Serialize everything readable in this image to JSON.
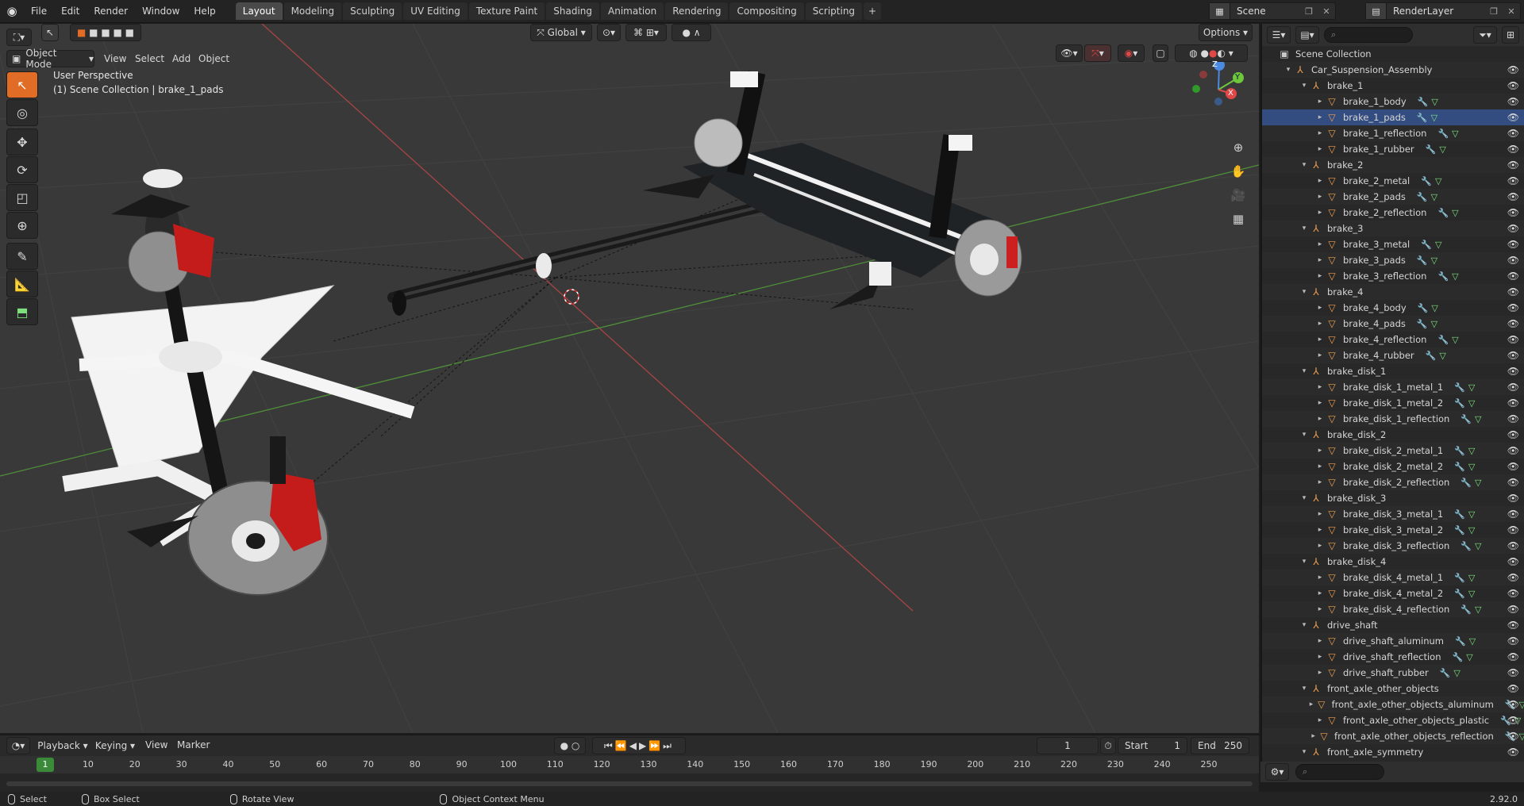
{
  "topbar": {
    "menus": [
      "File",
      "Edit",
      "Render",
      "Window",
      "Help"
    ],
    "workspaces": [
      "Layout",
      "Modeling",
      "Sculpting",
      "UV Editing",
      "Texture Paint",
      "Shading",
      "Animation",
      "Rendering",
      "Compositing",
      "Scripting"
    ],
    "active_workspace": "Layout",
    "add_label": "+",
    "scene": "Scene",
    "render_layer": "RenderLayer"
  },
  "viewport": {
    "mode": "Object Mode",
    "menus": [
      "View",
      "Select",
      "Add",
      "Object"
    ],
    "transform_orientation": "Global",
    "options_label": "Options",
    "perspective_label": "User Perspective",
    "collection_label": "(1) Scene Collection | brake_1_pads"
  },
  "gizmo": {
    "x": "X",
    "y": "Y",
    "z": "Z"
  },
  "outliner": {
    "search_placeholder": "",
    "rows": [
      {
        "name": "Scene Collection",
        "level": 0,
        "kind": "scene"
      },
      {
        "name": "Car_Suspension_Assembly",
        "level": 1,
        "kind": "empty"
      },
      {
        "name": "brake_1",
        "level": 2,
        "kind": "empty"
      },
      {
        "name": "brake_1_body",
        "level": 3,
        "kind": "mesh"
      },
      {
        "name": "brake_1_pads",
        "level": 3,
        "kind": "mesh",
        "selected": true
      },
      {
        "name": "brake_1_reflection",
        "level": 3,
        "kind": "mesh"
      },
      {
        "name": "brake_1_rubber",
        "level": 3,
        "kind": "mesh"
      },
      {
        "name": "brake_2",
        "level": 2,
        "kind": "empty"
      },
      {
        "name": "brake_2_metal",
        "level": 3,
        "kind": "mesh"
      },
      {
        "name": "brake_2_pads",
        "level": 3,
        "kind": "mesh"
      },
      {
        "name": "brake_2_reflection",
        "level": 3,
        "kind": "mesh"
      },
      {
        "name": "brake_3",
        "level": 2,
        "kind": "empty"
      },
      {
        "name": "brake_3_metal",
        "level": 3,
        "kind": "mesh"
      },
      {
        "name": "brake_3_pads",
        "level": 3,
        "kind": "mesh"
      },
      {
        "name": "brake_3_reflection",
        "level": 3,
        "kind": "mesh"
      },
      {
        "name": "brake_4",
        "level": 2,
        "kind": "empty"
      },
      {
        "name": "brake_4_body",
        "level": 3,
        "kind": "mesh"
      },
      {
        "name": "brake_4_pads",
        "level": 3,
        "kind": "mesh"
      },
      {
        "name": "brake_4_reflection",
        "level": 3,
        "kind": "mesh"
      },
      {
        "name": "brake_4_rubber",
        "level": 3,
        "kind": "mesh"
      },
      {
        "name": "brake_disk_1",
        "level": 2,
        "kind": "empty"
      },
      {
        "name": "brake_disk_1_metal_1",
        "level": 3,
        "kind": "mesh"
      },
      {
        "name": "brake_disk_1_metal_2",
        "level": 3,
        "kind": "mesh"
      },
      {
        "name": "brake_disk_1_reflection",
        "level": 3,
        "kind": "mesh"
      },
      {
        "name": "brake_disk_2",
        "level": 2,
        "kind": "empty"
      },
      {
        "name": "brake_disk_2_metal_1",
        "level": 3,
        "kind": "mesh"
      },
      {
        "name": "brake_disk_2_metal_2",
        "level": 3,
        "kind": "mesh"
      },
      {
        "name": "brake_disk_2_reflection",
        "level": 3,
        "kind": "mesh"
      },
      {
        "name": "brake_disk_3",
        "level": 2,
        "kind": "empty"
      },
      {
        "name": "brake_disk_3_metal_1",
        "level": 3,
        "kind": "mesh"
      },
      {
        "name": "brake_disk_3_metal_2",
        "level": 3,
        "kind": "mesh"
      },
      {
        "name": "brake_disk_3_reflection",
        "level": 3,
        "kind": "mesh"
      },
      {
        "name": "brake_disk_4",
        "level": 2,
        "kind": "empty"
      },
      {
        "name": "brake_disk_4_metal_1",
        "level": 3,
        "kind": "mesh"
      },
      {
        "name": "brake_disk_4_metal_2",
        "level": 3,
        "kind": "mesh"
      },
      {
        "name": "brake_disk_4_reflection",
        "level": 3,
        "kind": "mesh"
      },
      {
        "name": "drive_shaft",
        "level": 2,
        "kind": "empty"
      },
      {
        "name": "drive_shaft_aluminum",
        "level": 3,
        "kind": "mesh"
      },
      {
        "name": "drive_shaft_reflection",
        "level": 3,
        "kind": "mesh"
      },
      {
        "name": "drive_shaft_rubber",
        "level": 3,
        "kind": "mesh"
      },
      {
        "name": "front_axle_other_objects",
        "level": 2,
        "kind": "empty"
      },
      {
        "name": "front_axle_other_objects_aluminum",
        "level": 3,
        "kind": "mesh"
      },
      {
        "name": "front_axle_other_objects_plastic",
        "level": 3,
        "kind": "mesh"
      },
      {
        "name": "front_axle_other_objects_reflection",
        "level": 3,
        "kind": "mesh"
      },
      {
        "name": "front_axle_symmetry",
        "level": 2,
        "kind": "empty"
      }
    ]
  },
  "timeline": {
    "menus": [
      "Playback",
      "Keying",
      "View",
      "Marker"
    ],
    "current_frame": "1",
    "start_label": "Start",
    "start": "1",
    "end_label": "End",
    "end": "250",
    "ticks": [
      "10",
      "20",
      "30",
      "40",
      "50",
      "60",
      "70",
      "80",
      "90",
      "100",
      "110",
      "120",
      "130",
      "140",
      "150",
      "160",
      "170",
      "180",
      "190",
      "200",
      "210",
      "220",
      "230",
      "240",
      "250"
    ],
    "frame_indicator": "1"
  },
  "status": {
    "items": [
      "Select",
      "Box Select",
      "Rotate View",
      "Object Context Menu"
    ],
    "version": "2.92.0"
  },
  "colors": {
    "accent": "#4772b3",
    "x_axis": "#e04848",
    "y_axis": "#6ec83c",
    "z_axis": "#4a8ae0",
    "empty_icon": "#f0a050",
    "mesh_data": "#7de07d",
    "modifier": "#6fa8e8"
  }
}
